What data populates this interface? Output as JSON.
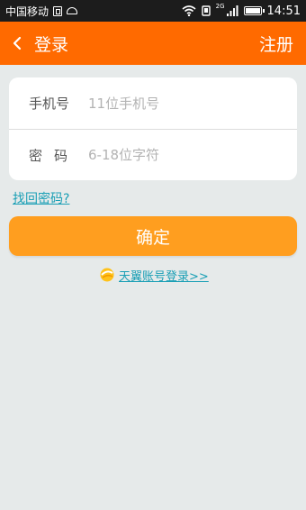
{
  "status_bar": {
    "carrier": "中国移动",
    "network": "2G",
    "time": "14:51"
  },
  "header": {
    "title": "登录",
    "register_label": "注册"
  },
  "form": {
    "phone_label": "手机号",
    "phone_placeholder": "11位手机号",
    "password_label": "密码",
    "password_placeholder": "6-18位字符"
  },
  "forgot_password_label": "找回密码?",
  "confirm_label": "确定",
  "tianyi_login_label": "天翼账号登录>>",
  "colors": {
    "header_bg": "#ff6a00",
    "button_bg": "#ff9e1f",
    "link": "#1a9fb5",
    "page_bg": "#e6eaea"
  }
}
